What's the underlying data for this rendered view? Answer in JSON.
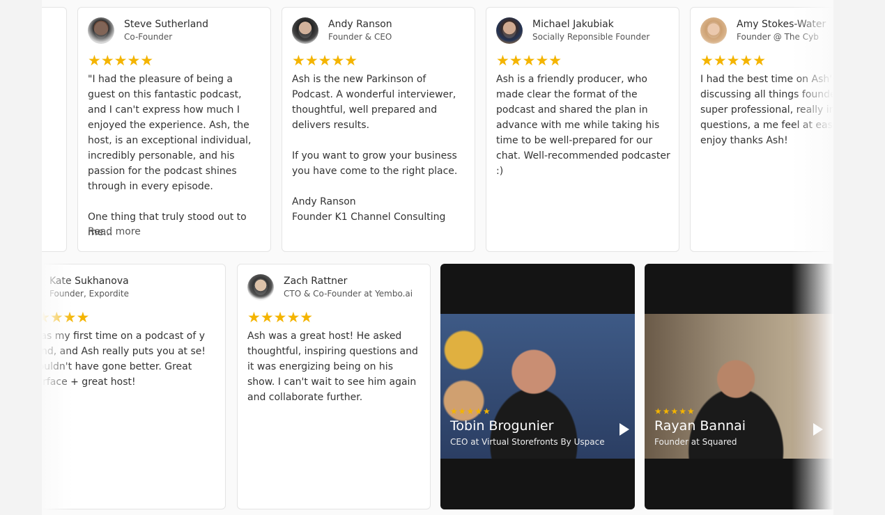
{
  "row1": [
    {
      "name": "Steve Sutherland",
      "role": "Co-Founder",
      "stars": "★★★★★",
      "text": "\"I had the pleasure of being a guest on this fantastic podcast, and I can't express how much I enjoyed the experience. Ash, the host, is an exceptional individual, incredibly personable, and his passion for the podcast shines through in every episode.\n\nOne thing that truly stood out to me...",
      "read_more": "Read more"
    },
    {
      "name": "Andy Ranson",
      "role": "Founder & CEO",
      "stars": "★★★★★",
      "text": "Ash is the new Parkinson of Podcast. A wonderful interviewer, thoughtful, well prepared and delivers results.\n\nIf you want to grow your business you have come to the right place.\n\nAndy Ranson\nFounder K1 Channel Consulting"
    },
    {
      "name": "Michael Jakubiak",
      "role": "Socially Reponsible Founder",
      "stars": "★★★★★",
      "text": "Ash is a friendly producer, who made clear the format of the podcast and shared the plan in advance with me while taking his time to be well-prepared for our chat. Well-recommended podcaster :)"
    },
    {
      "name": "Amy Stokes-Water",
      "role": "Founder @ The Cyb",
      "stars": "★★★★★",
      "text": "I had the best time on Ash's discussing all things founde He was super professional, really insightful questions, a me feel at ease. Really enjoy thanks Ash!"
    }
  ],
  "row2": [
    {
      "name": "Kate Sukhanova",
      "role": "Founder, Expordite",
      "stars": "★★★★",
      "text": "was my first time on a podcast of y kind, and Ash really puts you at se! couldn't have gone better. Great terface + great host!"
    },
    {
      "name": "Zach Rattner",
      "role": "CTO & Co-Founder at Yembo.ai",
      "stars": "★★★★★",
      "text": "Ash was a great host! He asked thoughtful, inspiring questions and it was energizing being on his show. I can't wait to see him again and collaborate further."
    }
  ],
  "videos": [
    {
      "stars": "★★★★★",
      "name": "Tobin Brogunier",
      "role": "CEO at Virtual Storefronts By Uspace"
    },
    {
      "stars": "★★★★★",
      "name": "Rayan Bannai",
      "role": "Founder at Squared"
    }
  ],
  "colors": {
    "star": "#f4b400",
    "card_border": "#e4e4e4",
    "background": "#fafafa"
  },
  "icons": {
    "play": "play-icon",
    "avatar": "avatar"
  }
}
